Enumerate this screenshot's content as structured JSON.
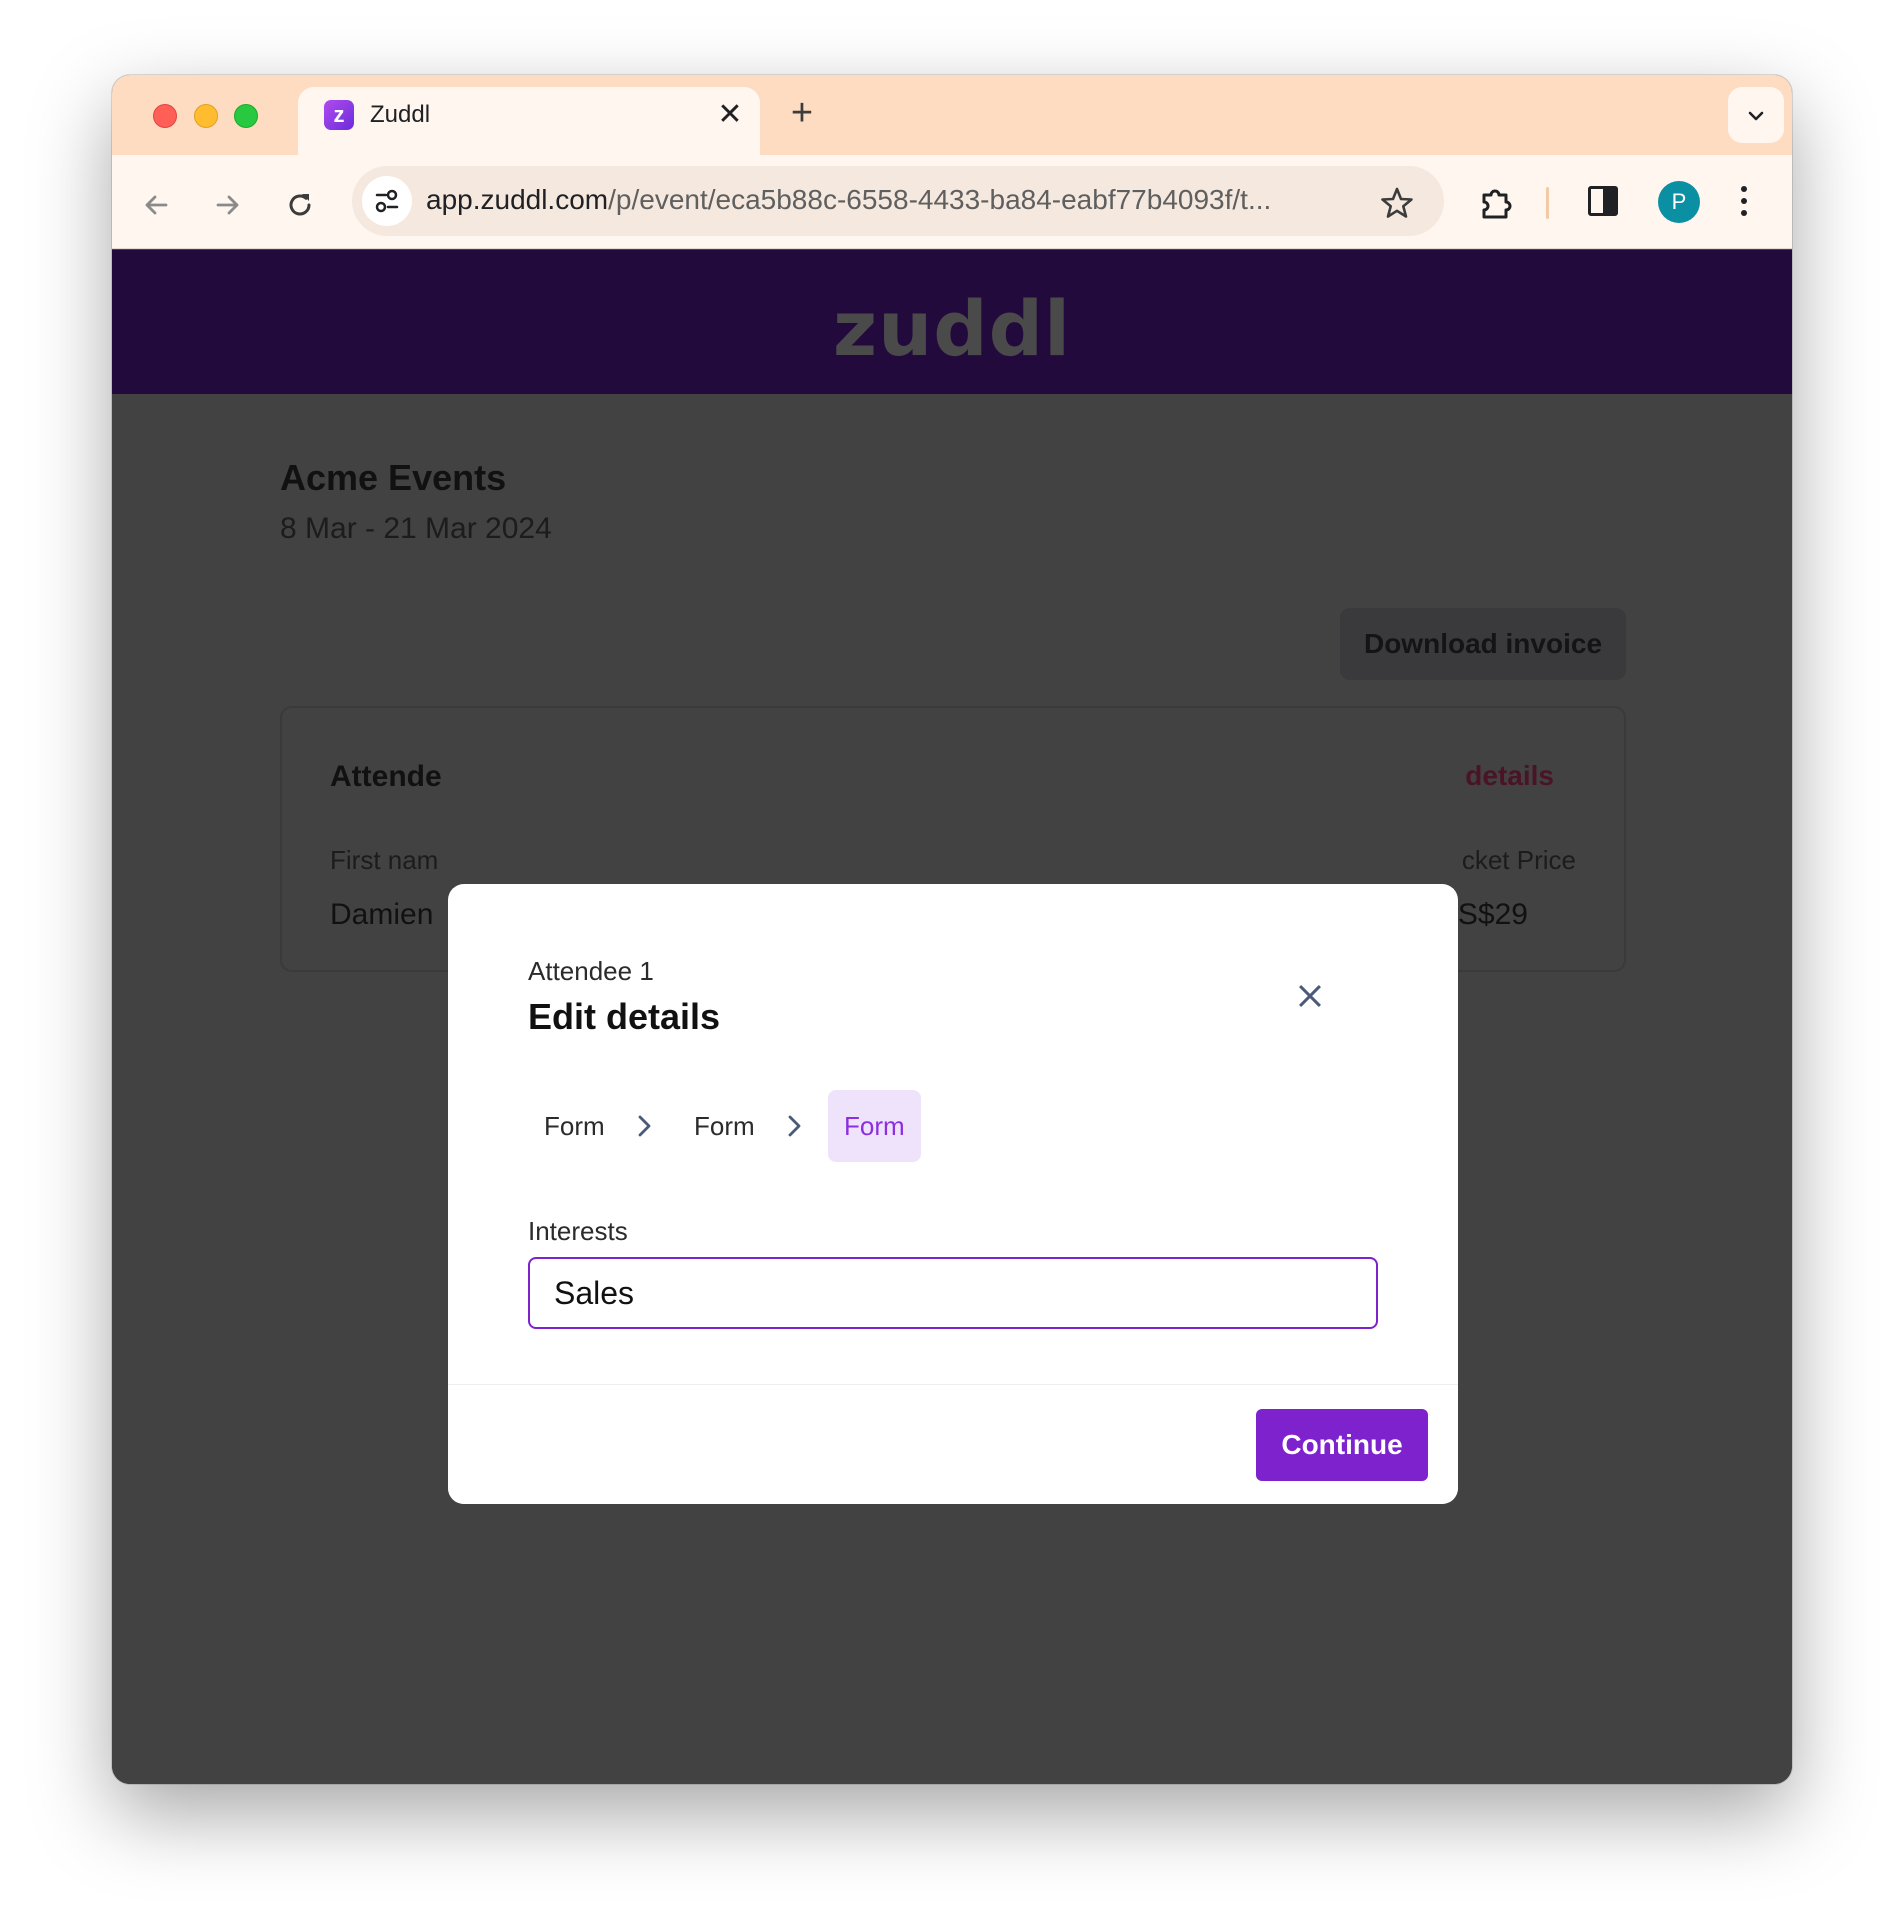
{
  "browser": {
    "tab_title": "Zuddl",
    "tab_favicon_letter": "z",
    "tab_close": "✕",
    "new_tab": "+",
    "url_host": "app.zuddl.com",
    "url_path": "/p/event/eca5b88c-6558-4433-ba84-eabf77b4093f/t...",
    "avatar_letter": "P"
  },
  "page": {
    "brand": "zuddl",
    "event_title": "Acme Events",
    "event_dates": "8 Mar - 21 Mar 2024",
    "download_invoice": "Download invoice",
    "card": {
      "title": "Attende",
      "edit_label": "details",
      "first_name_label": "First nam",
      "first_name_value": "Damien",
      "ticket_price_label": "cket Price",
      "ticket_price_value": "S$29"
    }
  },
  "modal": {
    "subtitle": "Attendee 1",
    "title": "Edit details",
    "steps": [
      "Form",
      "Form",
      "Form"
    ],
    "active_step": 3,
    "field_label": "Interests",
    "field_value": "Sales",
    "continue_label": "Continue"
  },
  "colors": {
    "accent": "#7e22ce",
    "brand_bar": "#220b3c",
    "tabstrip": "#fedcc2"
  }
}
